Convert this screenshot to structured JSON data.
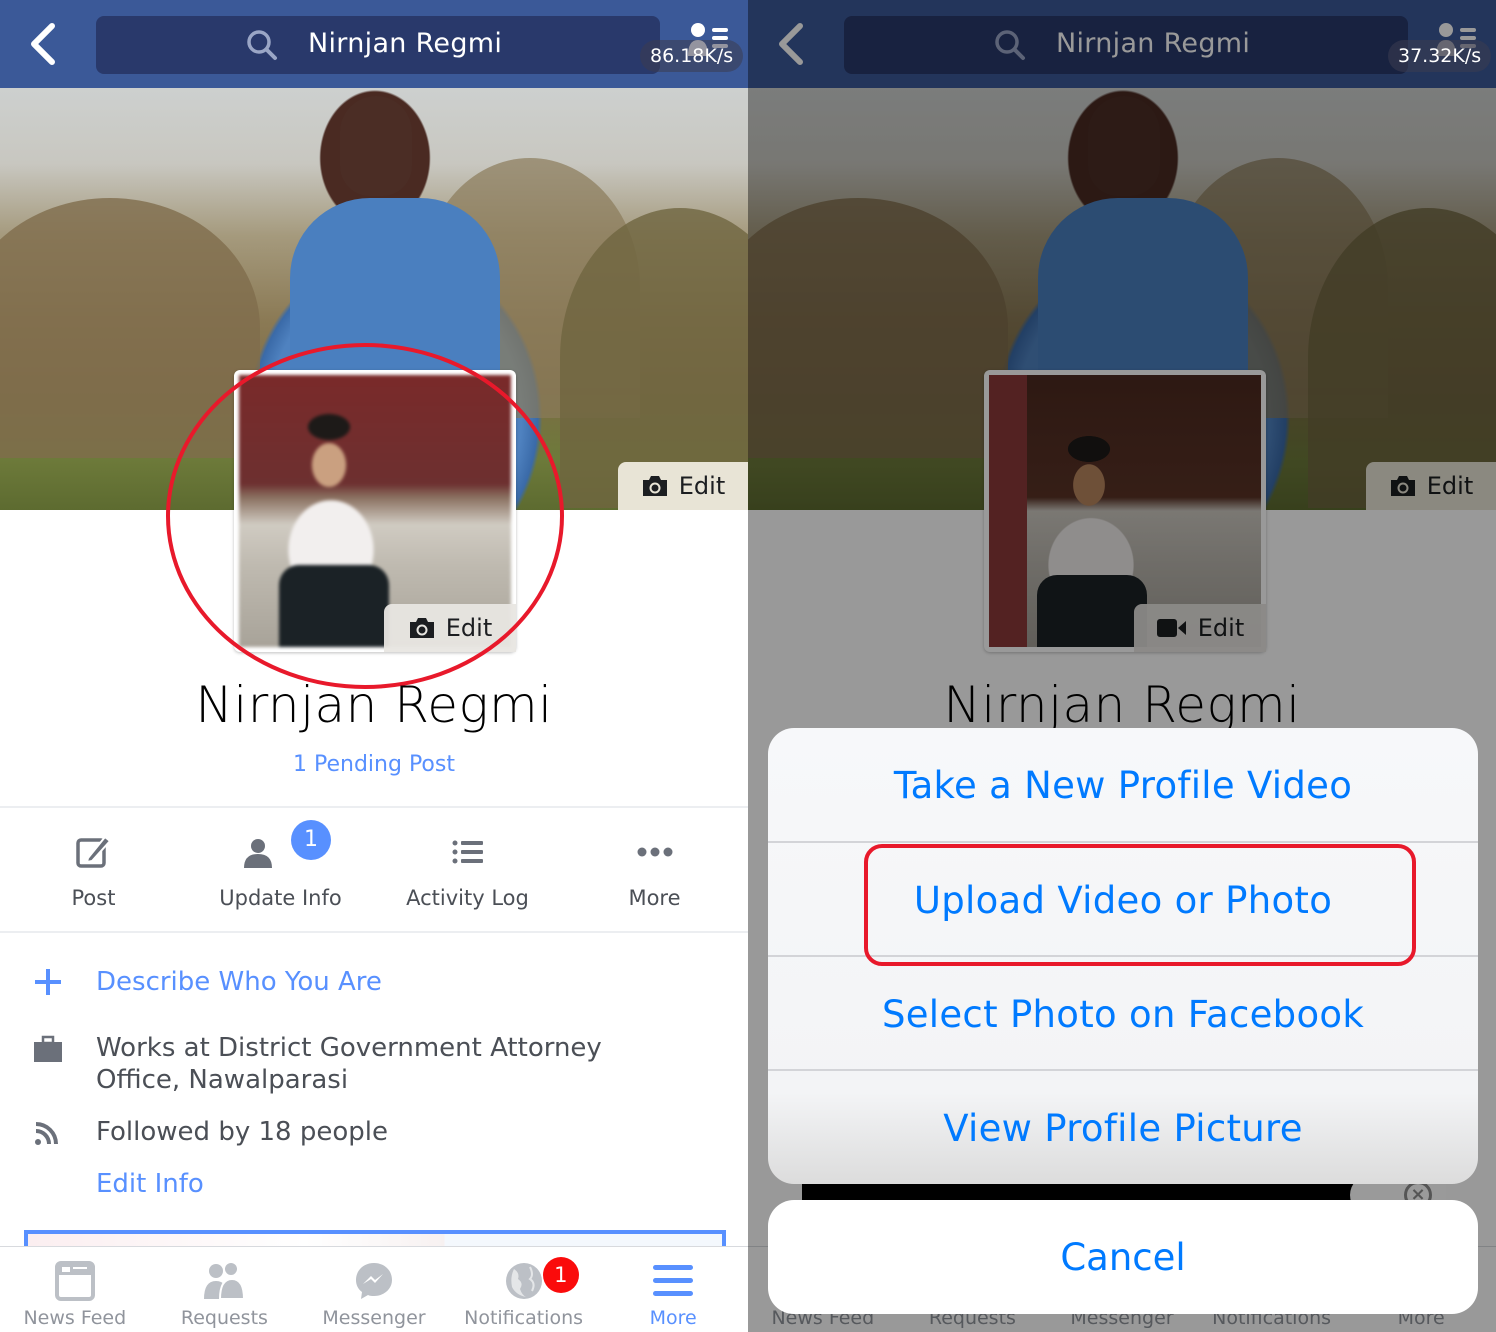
{
  "colors": {
    "navbar": "#3b5998",
    "search_field": "#29396b",
    "link_blue": "#5890ff",
    "ios_blue": "#007aff",
    "annotation_red": "#e8192b",
    "notification_red": "#fa0b0b",
    "text_gray": "#4b4f56",
    "tab_gray": "#90949c"
  },
  "left": {
    "navbar": {
      "back_icon": "chevron-left-icon",
      "search_icon": "search-icon",
      "search_value": "Nirnjan Regmi",
      "friends_icon": "friends-list-icon",
      "network_speed": "86.18K/s"
    },
    "cover": {
      "edit_label": "Edit",
      "edit_icon": "camera-icon"
    },
    "profile_picture": {
      "edit_label": "Edit",
      "edit_icon": "camera-icon",
      "annotation": "red-circle"
    },
    "profile": {
      "name": "Nirnjan Regmi",
      "pending": "1 Pending Post"
    },
    "actions": [
      {
        "label": "Post",
        "icon": "compose-icon"
      },
      {
        "label": "Update Info",
        "icon": "person-icon",
        "badge": "1"
      },
      {
        "label": "Activity Log",
        "icon": "list-icon"
      },
      {
        "label": "More",
        "icon": "more-dots-icon"
      }
    ],
    "intro": {
      "describe": {
        "icon": "plus-icon",
        "text": "Describe Who You Are"
      },
      "work": {
        "icon": "briefcase-icon",
        "line1": "Works at District Government Attorney",
        "line2": "Office, Nawalparasi"
      },
      "followers": {
        "icon": "rss-icon",
        "text": "Followed by 18 people"
      },
      "edit_info": "Edit Info"
    },
    "tabbar": [
      {
        "label": "News Feed",
        "icon": "news-feed-icon"
      },
      {
        "label": "Requests",
        "icon": "friend-requests-icon"
      },
      {
        "label": "Messenger",
        "icon": "messenger-icon"
      },
      {
        "label": "Notifications",
        "icon": "globe-icon",
        "badge": "1"
      },
      {
        "label": "More",
        "icon": "hamburger-menu-icon",
        "active": true
      }
    ]
  },
  "right": {
    "navbar": {
      "search_value": "Nirnjan Regmi",
      "network_speed": "37.32K/s"
    },
    "cover": {
      "edit_label": "Edit",
      "edit_icon": "camera-icon"
    },
    "profile_picture": {
      "edit_label": "Edit",
      "edit_icon": "video-camera-icon"
    },
    "profile": {
      "name": "Nirnjan Regmi"
    },
    "action_sheet": {
      "options": [
        "Take a New Profile Video",
        "Upload Video or Photo",
        "Select Photo on Facebook",
        "View Profile Picture"
      ],
      "highlighted_option": "Upload Video or Photo",
      "cancel": "Cancel"
    },
    "tabbar": [
      {
        "label": "News Feed"
      },
      {
        "label": "Requests"
      },
      {
        "label": "Messenger"
      },
      {
        "label": "Notifications"
      },
      {
        "label": "More"
      }
    ]
  }
}
